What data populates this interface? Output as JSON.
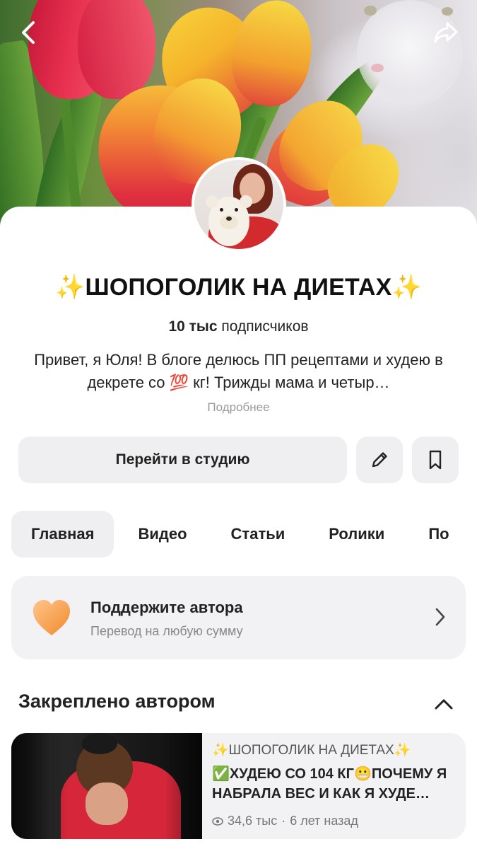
{
  "channel": {
    "name": "ШОПОГОЛИК НА ДИЕТАХ",
    "spark_left": "✨",
    "spark_right": "✨",
    "subscribers_count": "10 тыс",
    "subscribers_label": "подписчиков",
    "description": "Привет, я Юля! В блоге делюсь ПП рецептами и худею в декрете со 💯 кг! Трижды мама и четыр…",
    "more_label": "Подробнее"
  },
  "actions": {
    "studio_label": "Перейти в студию",
    "edit_icon": "pencil-icon",
    "bookmark_icon": "bookmark-icon"
  },
  "tabs": [
    {
      "label": "Главная",
      "active": true
    },
    {
      "label": "Видео",
      "active": false
    },
    {
      "label": "Статьи",
      "active": false
    },
    {
      "label": "Ролики",
      "active": false
    },
    {
      "label": "По",
      "active": false
    }
  ],
  "support": {
    "title": "Поддержите автора",
    "subtitle": "Перевод на любую сумму",
    "icon": "heart-icon",
    "heart_color": "#f4a460"
  },
  "pinned": {
    "heading": "Закреплено автором",
    "item": {
      "channel": "✨ШОПОГОЛИК НА ДИЕТАХ✨",
      "title": "✅ХУДЕЮ СО 104 КГ😬ПОЧЕМУ Я НАБРАЛА ВЕС И КАК Я ХУДЕ…",
      "views": "34,6 тыс",
      "separator": "·",
      "age": "6 лет назад"
    }
  },
  "nav": {
    "back_icon": "back-arrow-icon",
    "share_icon": "share-icon"
  }
}
